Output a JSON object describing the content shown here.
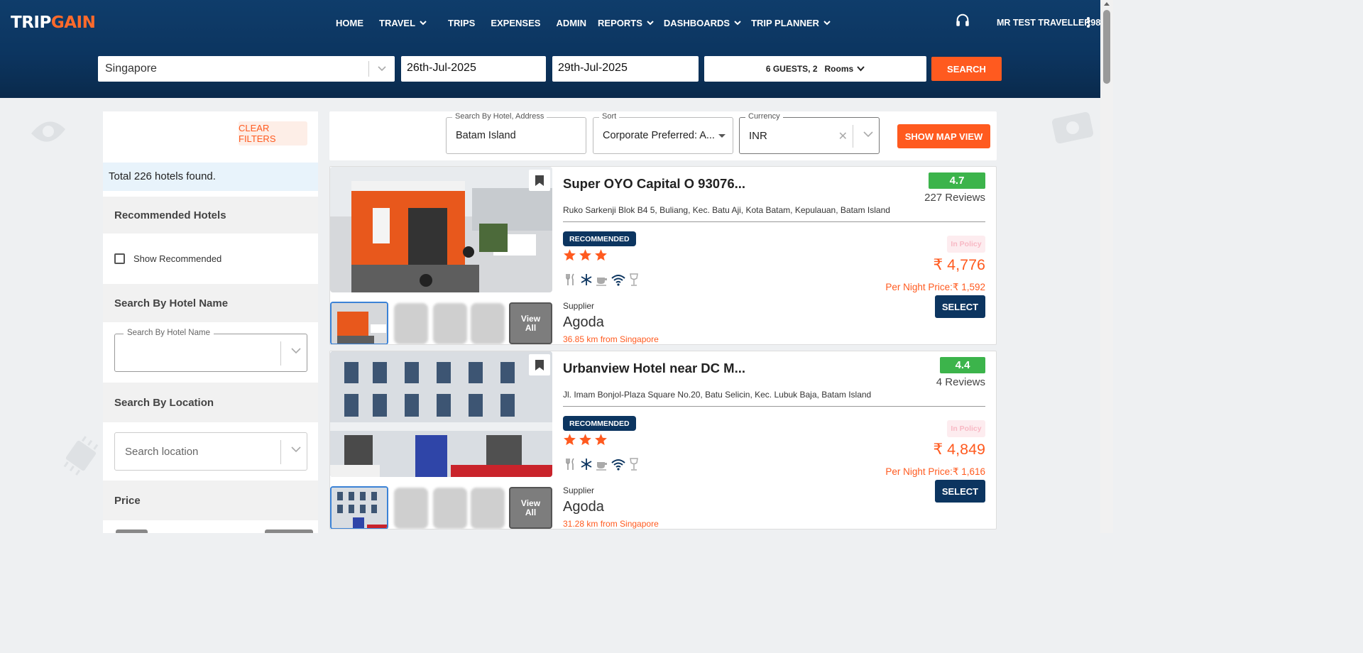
{
  "brand": {
    "logo_trip": "TRIP",
    "logo_gain": "GAIN"
  },
  "nav": {
    "items": [
      {
        "label": "HOME",
        "has_dropdown": false
      },
      {
        "label": "TRAVEL",
        "has_dropdown": true
      },
      {
        "label": "TRIPS",
        "has_dropdown": false
      },
      {
        "label": "EXPENSES",
        "has_dropdown": false
      },
      {
        "label": "ADMIN",
        "has_dropdown": false
      },
      {
        "label": "REPORTS",
        "has_dropdown": true
      },
      {
        "label": "DASHBOARDS",
        "has_dropdown": true
      },
      {
        "label": "TRIP PLANNER",
        "has_dropdown": true
      }
    ],
    "support_icon": "headset-icon",
    "user_name": "MR TEST TRAVELLER98"
  },
  "search": {
    "city": "Singapore",
    "check_in": "26th-Jul-2025",
    "check_out": "29th-Jul-2025",
    "guests": "6 GUESTS, 2",
    "rooms_label": "Rooms",
    "search_label": "SEARCH"
  },
  "sidebar": {
    "clear_filters": "CLEAR FILTERS",
    "total": "Total 226 hotels found.",
    "recommended_heading": "Recommended Hotels",
    "show_recommended": "Show Recommended",
    "show_recommended_checked": false,
    "hotel_name_heading": "Search By Hotel Name",
    "hotel_name_legend": "Search By Hotel Name",
    "location_heading": "Search By Location",
    "location_placeholder": "Search location",
    "price_heading": "Price"
  },
  "filter_bar": {
    "search_legend": "Search By Hotel, Address",
    "search_value": "Batam Island",
    "sort_legend": "Sort",
    "sort_value": "Corporate Preferred: A...",
    "currency_legend": "Currency",
    "currency_value": "INR",
    "map_button": "SHOW MAP VIEW"
  },
  "hotels": [
    {
      "name": "Super OYO Capital O 93076...",
      "rating": "4.7",
      "reviews": "227 Reviews",
      "address": "Ruko Sarkenji Blok B4 5, Buliang, Kec. Batu Aji, Kota Batam, Kepulauan, Batam Island",
      "badge": "RECOMMENDED",
      "stars": 3,
      "policy": "In Policy",
      "price": "₹ 4,776",
      "per_night": "Per Night Price:₹ 1,592",
      "supplier_label": "Supplier",
      "supplier": "Agoda",
      "distance": "36.85 km from Singapore",
      "select_label": "SELECT",
      "view_all": "View All"
    },
    {
      "name": "Urbanview Hotel near DC M...",
      "rating": "4.4",
      "reviews": "4 Reviews",
      "address": "Jl. Imam Bonjol-Plaza Square No.20, Batu Selicin, Kec. Lubuk Baja, Batam Island",
      "badge": "RECOMMENDED",
      "stars": 3,
      "policy": "In Policy",
      "price": "₹ 4,849",
      "per_night": "Per Night Price:₹ 1,616",
      "supplier_label": "Supplier",
      "supplier": "Agoda",
      "distance": "31.28 km from Singapore",
      "select_label": "SELECT",
      "view_all": "View All"
    }
  ],
  "amenity_icons": [
    "restaurant-icon",
    "air-conditioning-icon",
    "coffee-icon",
    "wifi-icon",
    "bar-icon"
  ],
  "colors": {
    "header": "#0c3560",
    "accent": "#ff5a1f",
    "rating_green": "#3cb44b",
    "badge_navy": "#0c3560"
  }
}
